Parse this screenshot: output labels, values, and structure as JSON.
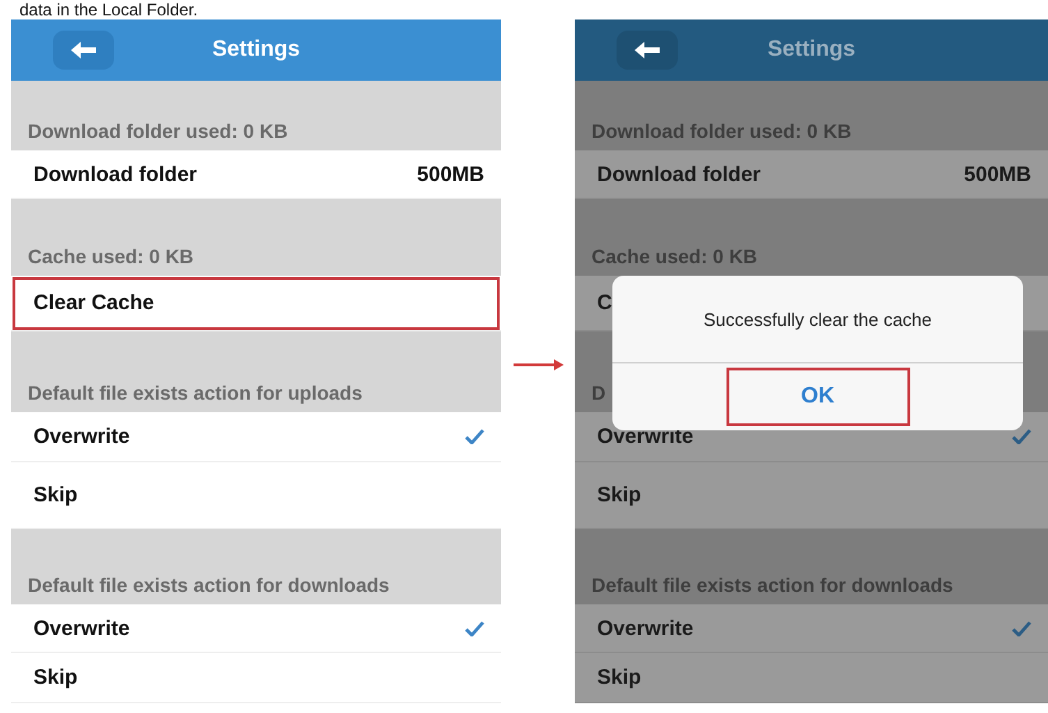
{
  "caption": "data in the Local Folder.",
  "screens": [
    {
      "title": "Settings",
      "dimmed": false,
      "sections": [
        {
          "header": "Download folder used: 0 KB",
          "rows": [
            {
              "label": "Download folder",
              "value": "500MB",
              "highlighted": false
            }
          ]
        },
        {
          "header": "Cache used: 0 KB",
          "rows": [
            {
              "label": "Clear Cache",
              "highlighted": true
            }
          ]
        },
        {
          "header": "Default file exists action for uploads",
          "rows": [
            {
              "label": "Overwrite",
              "checked": true,
              "highlighted": false
            },
            {
              "label": "Skip",
              "checked": false,
              "highlighted": false
            }
          ]
        },
        {
          "header": "Default file exists action for downloads",
          "rows": [
            {
              "label": "Overwrite",
              "checked": true,
              "highlighted": false
            },
            {
              "label": "Skip",
              "checked": false,
              "highlighted": false
            }
          ]
        }
      ]
    },
    {
      "title": "Settings",
      "dimmed": true,
      "sections": [
        {
          "header": "Download folder used: 0 KB",
          "rows": [
            {
              "label": "Download folder",
              "value": "500MB",
              "highlighted": false
            }
          ]
        },
        {
          "header": "Cache used: 0 KB",
          "rows": [
            {
              "label": "C",
              "highlighted": false
            }
          ]
        },
        {
          "header": "D",
          "rows": [
            {
              "label": "Overwrite",
              "checked": true,
              "highlighted": false
            },
            {
              "label": "Skip",
              "checked": false,
              "highlighted": false
            }
          ]
        },
        {
          "header": "Default file exists action for downloads",
          "rows": [
            {
              "label": "Overwrite",
              "checked": true,
              "highlighted": false
            },
            {
              "label": "Skip",
              "checked": false,
              "highlighted": false
            }
          ]
        }
      ],
      "dialog": {
        "message": "Successfully clear the cache",
        "button": {
          "label": "OK",
          "highlighted": true
        }
      }
    }
  ]
}
